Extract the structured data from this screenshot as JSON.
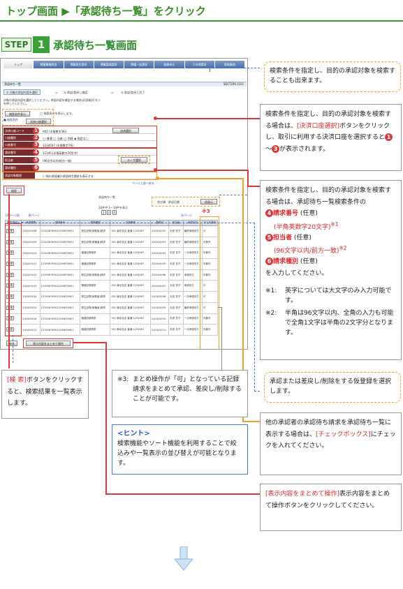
{
  "header": {
    "title": "トップ画面 ▶「承認待ち一覧」をクリック"
  },
  "step": {
    "label": "STEP",
    "number": "1",
    "title": "承認待ち一覧画面"
  },
  "screen": {
    "nav": [
      "トップ",
      "債権情報照会",
      "債権発生請求",
      "債権譲渡請求",
      "債権一括請求",
      "融資申込",
      "その他請求",
      "管理業務"
    ],
    "page_title": "承認待ち一覧",
    "screen_id": "SDCTOP11101",
    "flow": [
      "① 対象の承認内容を選択",
      "② 承認/差戻し確認",
      "③ 承認/差戻し完了"
    ],
    "instruction": "対象の承認内容を選択してください。承認内容を確認する場合は[詳細]ボタンを押してください。",
    "btn_search_open": "検索条件表示",
    "btn_search_open2": "決済口座選択",
    "search_section": "■ 検索条件",
    "form": [
      {
        "n": "1",
        "label": "決済口座コード",
        "value": "001 (半角数字3桁)"
      },
      {
        "n": "2",
        "label": "口座種別",
        "value": "◯ 普通 ◯ 当座 ◯ 別段 ◉ 指定なし"
      },
      {
        "n": "3",
        "label": "口座番号",
        "value": "1234567 (半角数字7桁)"
      },
      {
        "n": "4",
        "label": "請求番号",
        "value": "12345 (半角英数字20文字)"
      },
      {
        "n": "5",
        "label": "担当者",
        "value": "(96文字以内/前方一致)"
      },
      {
        "n": "6",
        "label": "請求種別",
        "value": ""
      },
      {
        "n": "",
        "label": "承認対象範囲",
        "value": "☐ 他の承認者の承認待ち請求も表示する"
      }
    ],
    "btn_account_select": "決済選択",
    "btn_user_select": "ユーザ選択",
    "btn_search": "検索",
    "list_title": "承認待ち一覧",
    "list_count": "20件中 1～10件を表示",
    "pages": [
      "1",
      "2",
      "3"
    ],
    "sort_label": "並び順 : 承認日順",
    "sort_btn": "再表示",
    "prev": "前ページ",
    "next": "次ページ",
    "prev_top": "10ページ前",
    "next_top": "次ページ",
    "mark3": "※3",
    "columns": [
      "承認/差戻し",
      "承認期限",
      "請求番号",
      "請求種別",
      "口座情報",
      "登録日",
      "担当者",
      "承認状況",
      "まとめ操作"
    ],
    "rows": [
      {
        "btn": "詳細",
        "date": "2010/04/08",
        "no": "123456789012345678901",
        "kind": "発生記録(債務者)請求",
        "acc": "001 東京支店 普通 1234567",
        "reg": "2010/04/02",
        "user": "杉田 花子",
        "status": "最終承認待ち",
        "op": "可"
      },
      {
        "btn": "詳細",
        "date": "2010/04/09",
        "no": "123456789012345678901",
        "kind": "発生記録(債権者)請求",
        "acc": "001 東京支店 普通 1234567",
        "reg": "2010/04/03",
        "user": "杉田 花子",
        "status": "最終承認待ち",
        "op": "対象外"
      },
      {
        "btn": "詳細",
        "date": "2010/04/10",
        "no": "123456789012345678901",
        "kind": "譲渡記録請求",
        "acc": "001 東京支店 普通 1234567",
        "reg": "2010/04/04",
        "user": "杉田 花子",
        "status": "一次承認待ち",
        "op": "対象外"
      },
      {
        "btn": "詳細",
        "date": "2010/04/11",
        "no": "123456789012345678901",
        "kind": "譲渡記録請求",
        "acc": "001 東京支店 普通 1234567",
        "reg": "2010/04/05",
        "user": "杉田 花子",
        "status": "一次承認待ち",
        "op": "対象外"
      },
      {
        "btn": "詳細",
        "date": "2010/04/12",
        "no": "123456789012345678901",
        "kind": "発生記録(債務者)請求",
        "acc": "001 東京支店 普通 1234567",
        "reg": "2010/04/06",
        "user": "杉田 花子",
        "status": "承認待ち",
        "op": "対象外"
      },
      {
        "btn": "詳細",
        "date": "2010/04/13",
        "no": "123456789012345678901",
        "kind": "譲渡記録請求",
        "acc": "001 東京支店 普通 1234567",
        "reg": "2010/04/07",
        "user": "杉田 花子",
        "status": "承認待ち",
        "op": "可"
      },
      {
        "btn": "詳細",
        "date": "2010/04/14",
        "no": "123456789012345678901",
        "kind": "発生記録(債務者)請求",
        "acc": "001 東京支店 普通 1234567",
        "reg": "2010/04/08",
        "user": "杉田 花子",
        "status": "一次承認待ち",
        "op": "可"
      },
      {
        "btn": "詳細",
        "date": "2010/04/15",
        "no": "123456789012345678901",
        "kind": "発生記録(債権者)請求",
        "acc": "001 東京支店 普通 1234567",
        "reg": "2010/04/09",
        "user": "杉田 花子",
        "status": "最終承認待ち",
        "op": "可"
      },
      {
        "btn": "詳細",
        "date": "2010/04/16",
        "no": "123456789012345678901",
        "kind": "譲渡記録請求",
        "acc": "001 東京支店 普通 1234567",
        "reg": "2010/04/10",
        "user": "杉田 花子",
        "status": "一次承認待ち",
        "op": "対象外"
      },
      {
        "btn": "詳細",
        "date": "2010/04/17",
        "no": "123456789012345678901",
        "kind": "譲渡記録請求",
        "acc": "001 東京支店 普通 1234567",
        "reg": "2010/04/11",
        "user": "杉田 花子",
        "status": "一次承認待ち",
        "op": "対象外"
      }
    ],
    "btn_back": "戻る",
    "btn_bulk": "表示内容をまとめて操作"
  },
  "callouts": {
    "c1": "検索条件を指定し、目的の承認対象を検索することも出来ます。",
    "c2_a": "検索条件を指定し、目的の承認対象を検索する場合は、",
    "c2_red": "[決済口座選択]",
    "c2_b": "ボタンをクリックし、取引に利用する決済口座を選択すると",
    "c2_c": "～",
    "c2_d": "が表示されます。",
    "c2_n1": "1",
    "c2_n3": "3",
    "c3_intro": "検索条件を指定し、目的の承認対象を検索する場合は、承認待ち一覧検索条件の",
    "c3_items": [
      {
        "n": "4",
        "label": "請求番号",
        "opt": "(任意)",
        "sub": "(半角英数字20文字)",
        "note": "※1"
      },
      {
        "n": "5",
        "label": "担当者",
        "opt": "(任意)",
        "sub": "(96文字以内/前方一致)",
        "note": "※2"
      },
      {
        "n": "6",
        "label": "請求種別",
        "opt": "(任意)",
        "sub": "",
        "note": ""
      }
    ],
    "c3_tail": "を入力してください。",
    "c3_note1_mark": "※1:",
    "c3_note1": "英字については大文字のみ入力可能です。",
    "c3_note2_mark": "※2:",
    "c3_note2": "半角は96文字以内、全角の入力も可能で全角1文字は半角の2文字分となります。",
    "c4": "承認または差戻し/削除をする仮登録を選択します。",
    "c5_a": "他の承認者の承認待ち請求を承認待ち一覧に表示する場合は、",
    "c5_red": "[チェックボックス]",
    "c5_b": "にチェックを入れてください。",
    "c6_red": "[表示内容をまとめて操作]",
    "c6_b": "表示内容をまとめて操作ボタンをクリックしてください。",
    "c7_red": "[検 索]",
    "c7_b": "ボタンをクリックすると、検索結果を一覧表示します。",
    "c8_mark": "※3:",
    "c8": "まとめ操作が「可」となっている記録請求をまとめて承認、差戻し/削除することが可能です。",
    "hint_title": "<ヒント>",
    "hint": "検索機能やソート機能を利用することで絞込みや一覧表示の並び替えが可能となります。"
  },
  "colors": {
    "accent_green": "#3a9a3a",
    "red": "#d43c3c",
    "orange": "#f0a030"
  }
}
